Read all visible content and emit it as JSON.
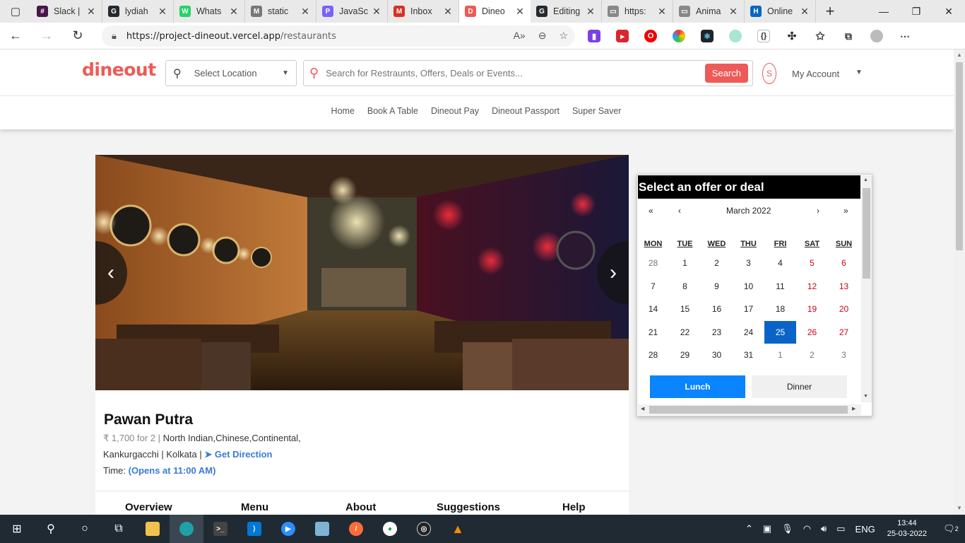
{
  "browser": {
    "tabs": [
      {
        "label": "Slack |",
        "color": "#4a154b",
        "glyph": "#"
      },
      {
        "label": "lydiah",
        "color": "#24292e",
        "glyph": "G"
      },
      {
        "label": "Whats",
        "color": "#25d366",
        "glyph": "W"
      },
      {
        "label": "static",
        "color": "#777777",
        "glyph": "M"
      },
      {
        "label": "JavaSc",
        "color": "#7b61ff",
        "glyph": "P"
      },
      {
        "label": "Inbox",
        "color": "#d93025",
        "glyph": "M"
      },
      {
        "label": "Dineo",
        "color": "#ed5a57",
        "glyph": "D"
      },
      {
        "label": "Editing",
        "color": "#24292e",
        "glyph": "G"
      },
      {
        "label": "https:",
        "color": "#888888",
        "glyph": "▭"
      },
      {
        "label": "Anima",
        "color": "#888888",
        "glyph": "▭"
      },
      {
        "label": "Online",
        "color": "#0a66c2",
        "glyph": "H"
      }
    ],
    "url_base": "https://project-dineout.vercel.app",
    "url_path": "/restaurants"
  },
  "site": {
    "logo": "dineout",
    "location_placeholder": "Select Location",
    "search_placeholder": "Search for Restraunts, Offers, Deals or Events...",
    "search_button": "Search",
    "avatar_initial": "S",
    "account_label": "My Account",
    "nav": [
      "Home",
      "Book A Table",
      "Dineout Pay",
      "Dineout Passport",
      "Super Saver"
    ]
  },
  "restaurant": {
    "name": "Pawan Putra",
    "price": "₹ 1,700 for 2 |",
    "cuisines": "North Indian,Chinese,Continental,",
    "locality": "Kankurgacchi | Kolkata |",
    "direction_label": "Get Direction",
    "time_label": "Time:",
    "opens": "(Opens at 11:00 AM)",
    "tabs": [
      "Overview",
      "Menu",
      "About",
      "Suggestions",
      "Help"
    ]
  },
  "offer": {
    "title": "Select an offer or deal",
    "month": "March 2022",
    "nav": {
      "first": "«",
      "prev": "‹",
      "next": "›",
      "last": "»"
    },
    "weekdays": [
      "MON",
      "TUE",
      "WED",
      "THU",
      "FRI",
      "SAT",
      "SUN"
    ],
    "weeks": [
      [
        "28",
        "1",
        "2",
        "3",
        "4",
        "5",
        "6"
      ],
      [
        "7",
        "8",
        "9",
        "10",
        "11",
        "12",
        "13"
      ],
      [
        "14",
        "15",
        "16",
        "17",
        "18",
        "19",
        "20"
      ],
      [
        "21",
        "22",
        "23",
        "24",
        "25",
        "26",
        "27"
      ],
      [
        "28",
        "29",
        "30",
        "31",
        "1",
        "2",
        "3"
      ]
    ],
    "selected_day": "25",
    "lunch": "Lunch",
    "dinner": "Dinner"
  },
  "taskbar": {
    "language": "ENG",
    "time": "13:44",
    "date": "25-03-2022",
    "notifications": "2"
  }
}
